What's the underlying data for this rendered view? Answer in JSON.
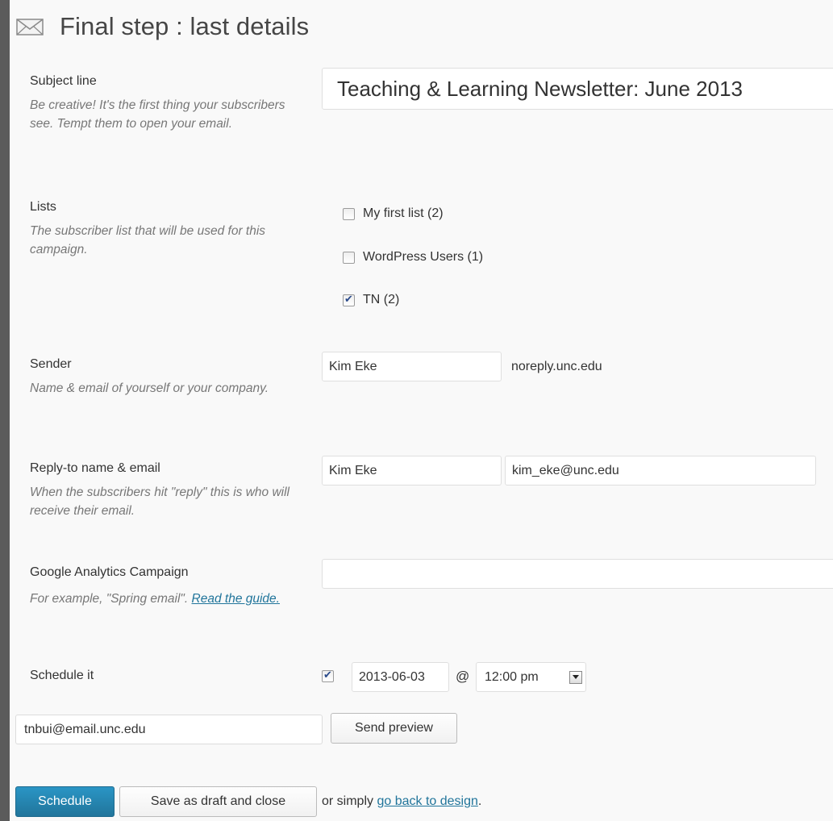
{
  "page": {
    "title": "Final step : last details",
    "icon": "envelope-icon"
  },
  "subject": {
    "label": "Subject line",
    "description": "Be creative! It's the first thing your subscribers see. Tempt them to open your email.",
    "value": "Teaching & Learning Newsletter: June 2013"
  },
  "lists": {
    "label": "Lists",
    "description": "The subscriber list that will be used for this campaign.",
    "items": [
      {
        "label": "My first list (2)",
        "checked": false
      },
      {
        "label": "WordPress Users (1)",
        "checked": false
      },
      {
        "label": "TN (2)",
        "checked": true
      }
    ]
  },
  "sender": {
    "label": "Sender",
    "description": "Name & email of yourself or your company.",
    "name": "Kim Eke",
    "email": "noreply.unc.edu"
  },
  "reply_to": {
    "label": "Reply-to name & email",
    "description": "When the subscribers hit \"reply\" this is who will receive their email.",
    "name": "Kim Eke",
    "email": "kim_eke@unc.edu"
  },
  "analytics": {
    "label": "Google Analytics Campaign",
    "description_prefix": "For example, \"Spring email\". ",
    "guide_link": "Read the guide.",
    "value": ""
  },
  "schedule": {
    "label": "Schedule it",
    "enabled": true,
    "date": "2013-06-03",
    "at": "@",
    "time": "12:00 pm"
  },
  "preview": {
    "email": "tnbui@email.unc.edu",
    "button": "Send preview"
  },
  "actions": {
    "schedule": "Schedule",
    "save_draft": "Save as draft and close",
    "or_text": "or simply ",
    "back_link": "go back to design",
    "trailing": "."
  }
}
